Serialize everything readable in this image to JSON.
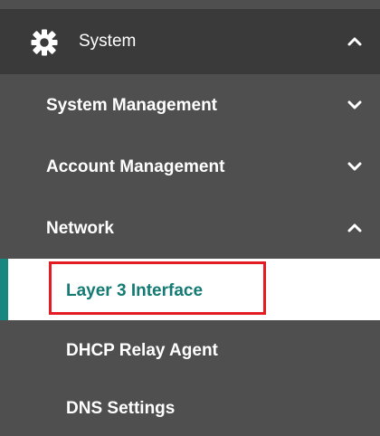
{
  "colors": {
    "menu_background": "#4f4f4f",
    "header_background": "#3a3a3a",
    "active_background": "#ffffff",
    "accent": "#17877f",
    "active_text": "#157a74",
    "highlight": "#e31b23"
  },
  "header": {
    "icon": "gear-icon",
    "label": "System",
    "state_icon": "chevron-up-icon"
  },
  "items": [
    {
      "label": "System Management",
      "state_icon": "chevron-down-icon"
    },
    {
      "label": "Account Management",
      "state_icon": "chevron-down-icon"
    },
    {
      "label": "Network",
      "state_icon": "chevron-up-icon"
    }
  ],
  "network_children": [
    {
      "label": "Layer 3 Interface",
      "active": true
    },
    {
      "label": "DHCP Relay Agent",
      "active": false
    },
    {
      "label": "DNS Settings",
      "active": false
    }
  ]
}
